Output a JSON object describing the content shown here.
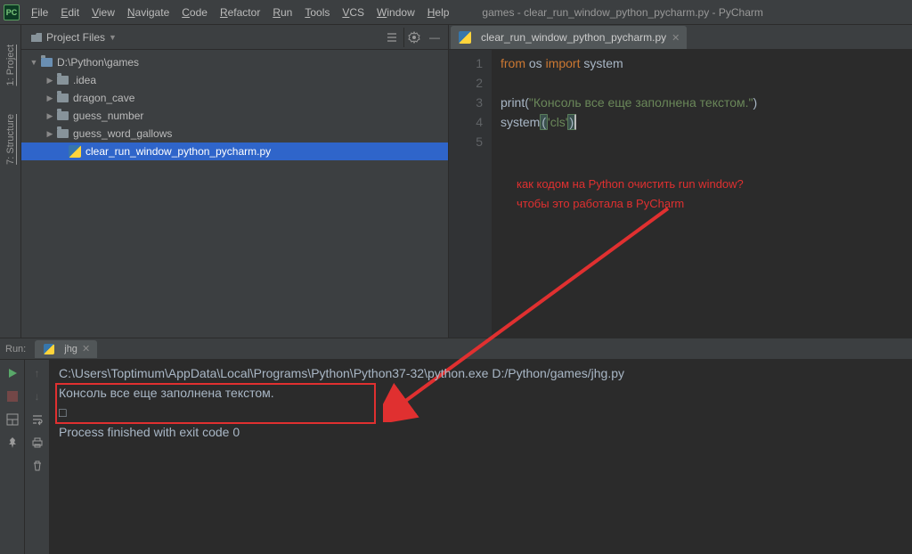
{
  "app_icon": "PC",
  "window_title": "games - clear_run_window_python_pycharm.py - PyCharm",
  "menu": [
    "File",
    "Edit",
    "View",
    "Navigate",
    "Code",
    "Refactor",
    "Run",
    "Tools",
    "VCS",
    "Window",
    "Help"
  ],
  "left_tabs": {
    "project": "1: Project",
    "structure": "7: Structure"
  },
  "panel": {
    "title": "Project Files",
    "root": "D:\\Python\\games",
    "children": [
      {
        "name": ".idea",
        "arrow": "▶"
      },
      {
        "name": "dragon_cave",
        "arrow": "▶"
      },
      {
        "name": "guess_number",
        "arrow": "▶"
      },
      {
        "name": "guess_word_gallows",
        "arrow": "▶"
      }
    ],
    "selected_file": "clear_run_window_python_pycharm.py"
  },
  "editor": {
    "tab": "clear_run_window_python_pycharm.py",
    "lines": [
      "1",
      "2",
      "3",
      "4",
      "5"
    ],
    "code": {
      "l1_kw1": "from",
      "l1_mod": "os",
      "l1_kw2": "import",
      "l1_name": "system",
      "l3_fn": "print",
      "l3_str": "\"Консоль все еще заполнена текстом.\"",
      "l4_fn": "system",
      "l4_str": "'cls'"
    }
  },
  "annotation": {
    "line1": "как кодом на Python очистить run window?",
    "line2": "чтобы это работала в PyCharm"
  },
  "run": {
    "label": "Run:",
    "tab": "jhg",
    "output": {
      "cmd": "C:\\Users\\Toptimum\\AppData\\Local\\Programs\\Python\\Python37-32\\python.exe D:/Python/games/jhg.py",
      "text1": "Консоль все еще заполнена текстом.",
      "text2": "□",
      "blank": "",
      "exit": "Process finished with exit code 0"
    }
  }
}
